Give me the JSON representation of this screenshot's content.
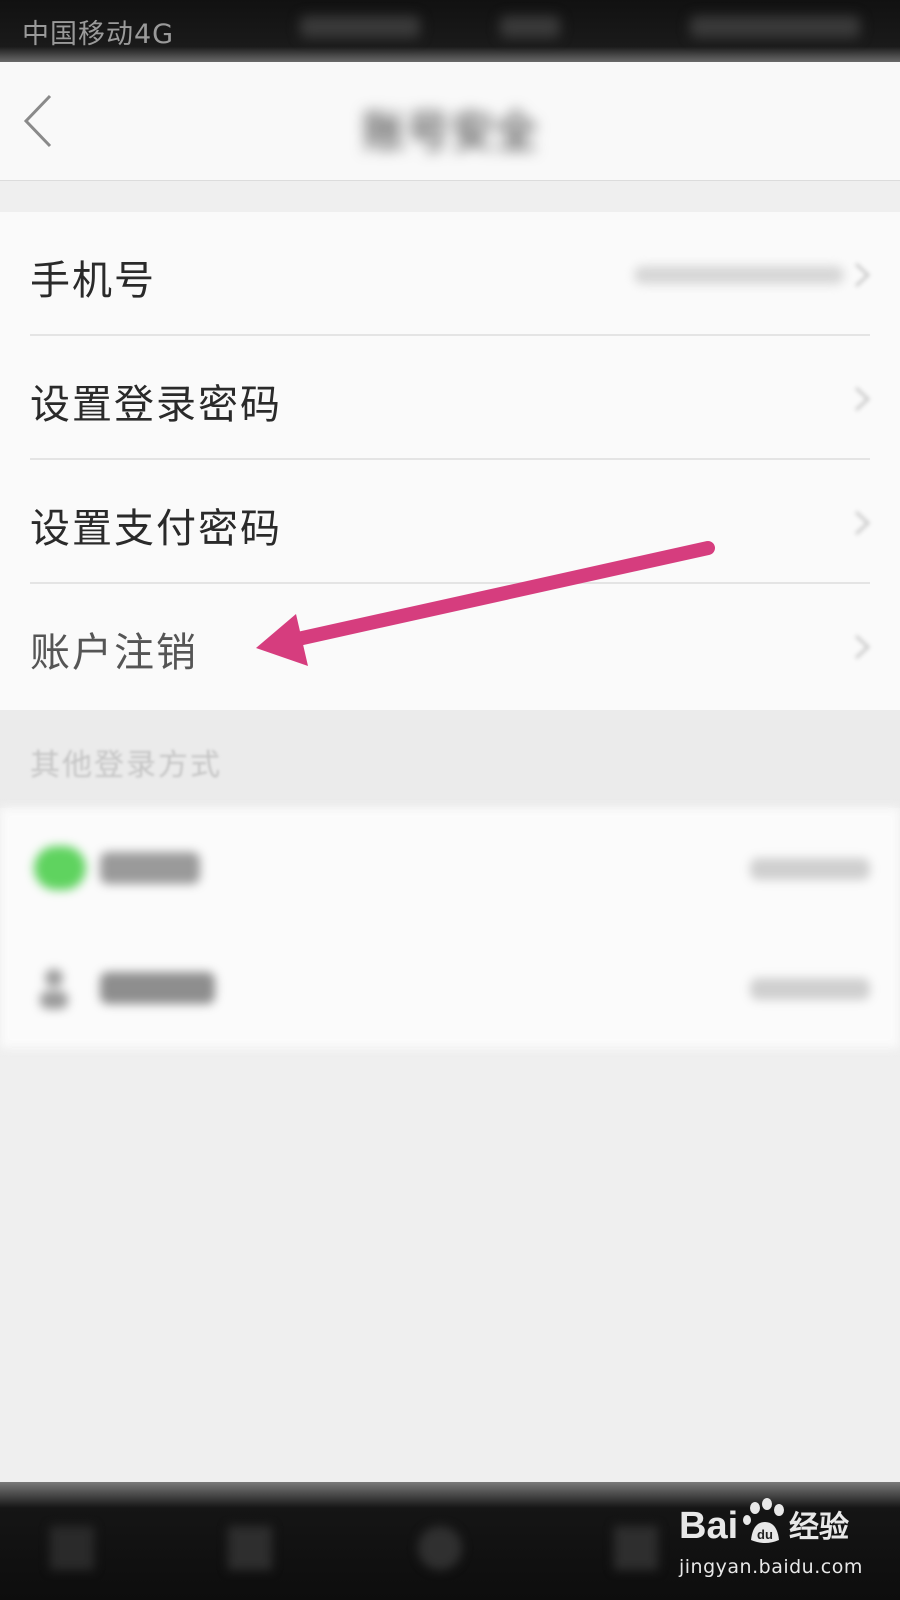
{
  "status_bar": {
    "carrier": "中国移动4G"
  },
  "nav": {
    "title": "账号安全"
  },
  "settings": {
    "items": [
      {
        "label": "手机号"
      },
      {
        "label": "设置登录密码"
      },
      {
        "label": "设置支付密码"
      },
      {
        "label": "账户注销"
      }
    ]
  },
  "other_login": {
    "section_label": "其他登录方式"
  },
  "colors": {
    "arrow": "#d63d7e",
    "wechat": "#5fd35f"
  },
  "icons": [
    "back-arrow-icon",
    "chevron-right-icon",
    "wechat-icon",
    "person-icon",
    "baidu-paw-icon"
  ],
  "watermark": {
    "brand_text": "经验",
    "url": "jingyan.baidu.com"
  }
}
